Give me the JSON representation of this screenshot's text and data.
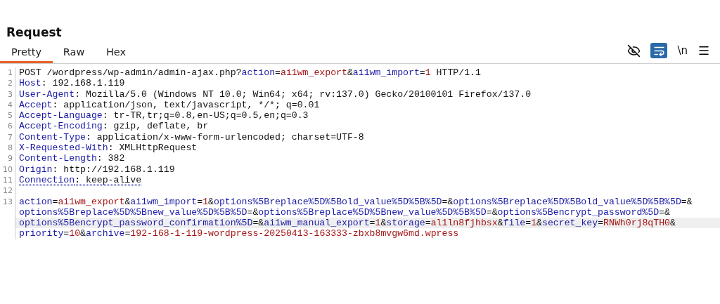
{
  "title": "Request",
  "tabs": [
    {
      "label": "Pretty",
      "selected": true
    },
    {
      "label": "Raw",
      "selected": false
    },
    {
      "label": "Hex",
      "selected": false
    }
  ],
  "toolbar": {
    "hide_on": false,
    "wrap_on": true,
    "newline_label": "\\n"
  },
  "lines": [
    {
      "number": "1",
      "rows": [
        {
          "highlighted": false,
          "underlined": false,
          "segments": [
            {
              "kind": "text",
              "text": "POST /wordpress/wp-admin/admin-ajax.php?"
            },
            {
              "kind": "key",
              "text": "action"
            },
            {
              "kind": "text",
              "text": "="
            },
            {
              "kind": "value",
              "text": "ai1wm_export"
            },
            {
              "kind": "text",
              "text": "&"
            },
            {
              "kind": "key",
              "text": "ai1wm_import"
            },
            {
              "kind": "text",
              "text": "="
            },
            {
              "kind": "value",
              "text": "1"
            },
            {
              "kind": "text",
              "text": " HTTP/1.1"
            }
          ]
        }
      ]
    },
    {
      "number": "2",
      "rows": [
        {
          "highlighted": false,
          "underlined": false,
          "segments": [
            {
              "kind": "key",
              "text": "Host"
            },
            {
              "kind": "text",
              "text": ": 192.168.1.119"
            }
          ]
        }
      ]
    },
    {
      "number": "3",
      "rows": [
        {
          "highlighted": false,
          "underlined": false,
          "segments": [
            {
              "kind": "key",
              "text": "User-Agent"
            },
            {
              "kind": "text",
              "text": ": Mozilla/5.0 (Windows NT 10.0; Win64; x64; rv:137.0) Gecko/20100101 Firefox/137.0"
            }
          ]
        }
      ]
    },
    {
      "number": "4",
      "rows": [
        {
          "highlighted": false,
          "underlined": false,
          "segments": [
            {
              "kind": "key",
              "text": "Accept"
            },
            {
              "kind": "text",
              "text": ": application/json, text/javascript, */*; q=0.01"
            }
          ]
        }
      ]
    },
    {
      "number": "5",
      "rows": [
        {
          "highlighted": false,
          "underlined": false,
          "segments": [
            {
              "kind": "key",
              "text": "Accept-Language"
            },
            {
              "kind": "text",
              "text": ": tr-TR,tr;q=0.8,en-US;q=0.5,en;q=0.3"
            }
          ]
        }
      ]
    },
    {
      "number": "6",
      "rows": [
        {
          "highlighted": false,
          "underlined": false,
          "segments": [
            {
              "kind": "key",
              "text": "Accept-Encoding"
            },
            {
              "kind": "text",
              "text": ": gzip, deflate, br"
            }
          ]
        }
      ]
    },
    {
      "number": "7",
      "rows": [
        {
          "highlighted": false,
          "underlined": false,
          "segments": [
            {
              "kind": "key",
              "text": "Content-Type"
            },
            {
              "kind": "text",
              "text": ": application/x-www-form-urlencoded; charset=UTF-8"
            }
          ]
        }
      ]
    },
    {
      "number": "8",
      "rows": [
        {
          "highlighted": false,
          "underlined": false,
          "segments": [
            {
              "kind": "key",
              "text": "X-Requested-With"
            },
            {
              "kind": "text",
              "text": ": XMLHttpRequest"
            }
          ]
        }
      ]
    },
    {
      "number": "9",
      "rows": [
        {
          "highlighted": false,
          "underlined": false,
          "segments": [
            {
              "kind": "key",
              "text": "Content-Length"
            },
            {
              "kind": "text",
              "text": ": 382"
            }
          ]
        }
      ]
    },
    {
      "number": "10",
      "rows": [
        {
          "highlighted": false,
          "underlined": false,
          "segments": [
            {
              "kind": "key",
              "text": "Origin"
            },
            {
              "kind": "text",
              "text": ": http://192.168.1.119"
            }
          ]
        }
      ]
    },
    {
      "number": "11",
      "rows": [
        {
          "highlighted": false,
          "underlined": true,
          "segments": [
            {
              "kind": "key",
              "text": "Connection"
            },
            {
              "kind": "text",
              "text": ": keep-alive"
            }
          ]
        }
      ]
    },
    {
      "number": "12"
    },
    {
      "number": "13",
      "rows": [
        {
          "highlighted": false,
          "underlined": false,
          "segments": [
            {
              "kind": "key",
              "text": "action"
            },
            {
              "kind": "text",
              "text": "="
            },
            {
              "kind": "value",
              "text": "ai1wm_export"
            },
            {
              "kind": "text",
              "text": "&"
            },
            {
              "kind": "key",
              "text": "ai1wm_import"
            },
            {
              "kind": "text",
              "text": "="
            },
            {
              "kind": "value",
              "text": "1"
            },
            {
              "kind": "text",
              "text": "&"
            },
            {
              "kind": "key",
              "text": "options%5Breplace%5D%5Bold_value%5D%5B%5D"
            },
            {
              "kind": "text",
              "text": "=&"
            },
            {
              "kind": "key",
              "text": "options%5Breplace%5D%5Bold_value%5D%5B%5D"
            },
            {
              "kind": "text",
              "text": "=&"
            }
          ]
        },
        {
          "highlighted": false,
          "underlined": false,
          "segments": [
            {
              "kind": "key",
              "text": "options%5Breplace%5D%5Bnew_value%5D%5B%5D"
            },
            {
              "kind": "text",
              "text": "=&"
            },
            {
              "kind": "key",
              "text": "options%5Breplace%5D%5Bnew_value%5D%5B%5D"
            },
            {
              "kind": "text",
              "text": "=&"
            },
            {
              "kind": "key",
              "text": "options%5Bencrypt_password%5D"
            },
            {
              "kind": "text",
              "text": "=&"
            }
          ]
        },
        {
          "highlighted": true,
          "underlined": false,
          "segments": [
            {
              "kind": "key",
              "text": "options%5Bencrypt_password_confirmation%5D"
            },
            {
              "kind": "text",
              "text": "=&"
            },
            {
              "kind": "key",
              "text": "ai1wm_manual_export"
            },
            {
              "kind": "text",
              "text": "="
            },
            {
              "kind": "value",
              "text": "1"
            },
            {
              "kind": "text",
              "text": "&"
            },
            {
              "kind": "key",
              "text": "storage"
            },
            {
              "kind": "text",
              "text": "="
            },
            {
              "kind": "value",
              "text": "al1ln8fjhbsx"
            },
            {
              "kind": "text",
              "text": "&"
            },
            {
              "kind": "key",
              "text": "file"
            },
            {
              "kind": "text",
              "text": "="
            },
            {
              "kind": "value",
              "text": "1"
            },
            {
              "kind": "text",
              "text": "&"
            },
            {
              "kind": "key",
              "text": "secret_key"
            },
            {
              "kind": "text",
              "text": "="
            },
            {
              "kind": "value",
              "text": "RNWh0rj8qTH0"
            },
            {
              "kind": "text",
              "text": "&"
            }
          ]
        },
        {
          "highlighted": false,
          "underlined": false,
          "segments": [
            {
              "kind": "key",
              "text": "priority"
            },
            {
              "kind": "text",
              "text": "="
            },
            {
              "kind": "value",
              "text": "10"
            },
            {
              "kind": "text",
              "text": "&"
            },
            {
              "kind": "key",
              "text": "archive"
            },
            {
              "kind": "text",
              "text": "="
            },
            {
              "kind": "value",
              "text": "192-168-1-119-wordpress-20250413-163333-zbxb8mvgw6md.wpress"
            }
          ]
        }
      ]
    }
  ]
}
